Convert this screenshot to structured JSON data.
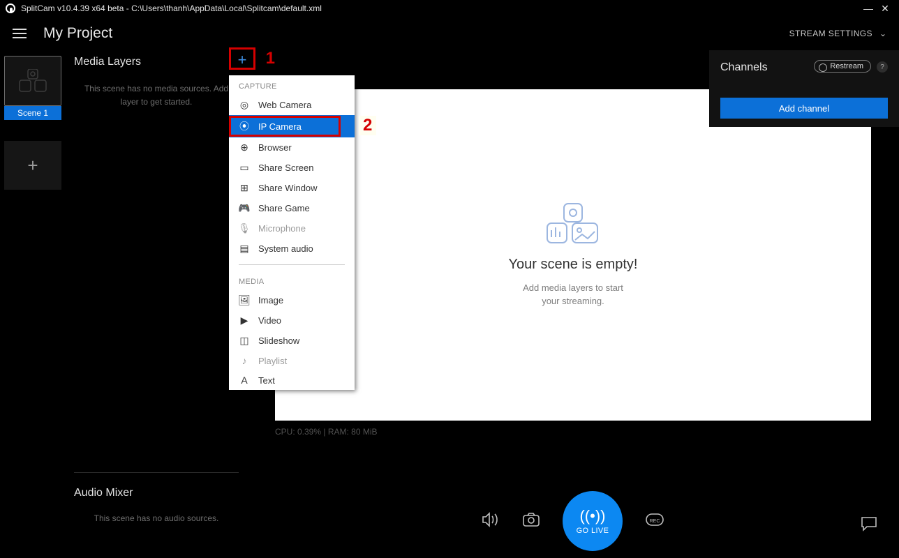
{
  "title": "SplitCam v10.4.39 x64 beta - C:\\Users\\thanh\\AppData\\Local\\Splitcam\\default.xml",
  "project_name": "My Project",
  "stream_settings_label": "STREAM SETTINGS",
  "scene": {
    "name": "Scene 1"
  },
  "layers": {
    "heading": "Media Layers",
    "empty1": "This scene has no media sources. Add",
    "empty2": "layer to get started."
  },
  "annotations": {
    "one": "1",
    "two": "2"
  },
  "menu": {
    "section_capture": "CAPTURE",
    "section_media": "MEDIA",
    "items_capture": [
      {
        "label": "Web Camera",
        "icon": "◎"
      },
      {
        "label": "IP Camera",
        "icon": "⦿",
        "selected": true
      },
      {
        "label": "Browser",
        "icon": "⊕"
      },
      {
        "label": "Share Screen",
        "icon": "▭"
      },
      {
        "label": "Share Window",
        "icon": "⊞"
      },
      {
        "label": "Share Game",
        "icon": "🎮"
      },
      {
        "label": "Microphone",
        "icon": "🎙",
        "disabled": true
      },
      {
        "label": "System audio",
        "icon": "▤"
      }
    ],
    "items_media": [
      {
        "label": "Image",
        "icon": "🖼"
      },
      {
        "label": "Video",
        "icon": "▶"
      },
      {
        "label": "Slideshow",
        "icon": "◫"
      },
      {
        "label": "Playlist",
        "icon": "♪",
        "disabled": true
      },
      {
        "label": "Text",
        "icon": "A"
      }
    ]
  },
  "preview": {
    "title": "Your scene is empty!",
    "sub1": "Add media layers to start",
    "sub2": "your streaming."
  },
  "cpu_ram": "CPU: 0.39% | RAM: 80 MiB",
  "golive_label": "GO LIVE",
  "channels": {
    "heading": "Channels",
    "restream": "Restream",
    "help": "?",
    "add": "Add channel"
  },
  "audio": {
    "heading": "Audio Mixer",
    "empty": "This scene has no audio sources."
  }
}
